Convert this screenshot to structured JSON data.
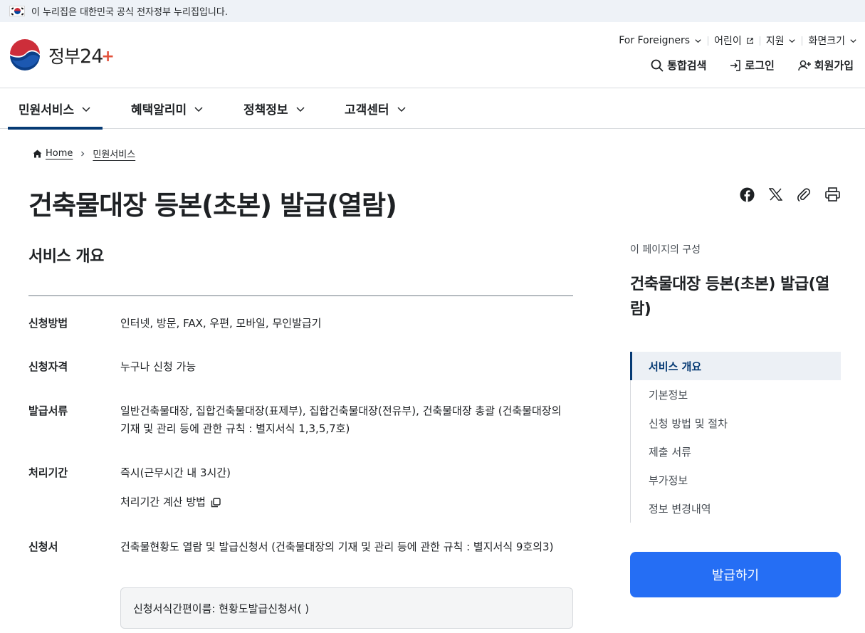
{
  "gov_banner": {
    "text": "이 누리집은 대한민국 공식 전자정부 누리집입니다."
  },
  "logo": {
    "text": "정부",
    "number": "24",
    "plus": "+"
  },
  "utility_menu": [
    {
      "label": "For Foreigners",
      "icon": "chevron-down-icon"
    },
    {
      "label": "어린이",
      "icon": "external-link-icon"
    },
    {
      "label": "지원",
      "icon": "chevron-down-icon"
    },
    {
      "label": "화면크기",
      "icon": "chevron-down-icon"
    }
  ],
  "header_actions": [
    {
      "label": "통합검색",
      "icon": "search-icon"
    },
    {
      "label": "로그인",
      "icon": "login-icon"
    },
    {
      "label": "회원가입",
      "icon": "user-plus-icon"
    }
  ],
  "nav": [
    {
      "label": "민원서비스",
      "active": true
    },
    {
      "label": "혜택알리미",
      "active": false
    },
    {
      "label": "정책정보",
      "active": false
    },
    {
      "label": "고객센터",
      "active": false
    }
  ],
  "breadcrumb": {
    "home": "Home",
    "current": "민원서비스"
  },
  "page_title": "건축물대장 등본(초본) 발급(열람)",
  "share_icons": [
    "facebook-icon",
    "x-twitter-icon",
    "link-attach-icon",
    "print-icon"
  ],
  "section_title": "서비스 개요",
  "info": {
    "method": {
      "label": "신청방법",
      "value": "인터넷, 방문, FAX, 우편, 모바일, 무인발급기"
    },
    "eligibility": {
      "label": "신청자격",
      "value": "누구나 신청 가능"
    },
    "documents": {
      "label": "발급서류",
      "value": "일반건축물대장, 집합건축물대장(표제부), 집합건축물대장(전유부), 건축물대장 총괄 (건축물대장의 기재 및 관리 등에 관한 규칙 : 별지서식 1,3,5,7호)"
    },
    "period": {
      "label": "처리기간",
      "value": "즉시(근무시간 내 3시간)",
      "link": "처리기간 계산 방법"
    },
    "form": {
      "label": "신청서",
      "value": "건축물현황도 열람 및 발급신청서 (건축물대장의 기재 및 관리 등에 관한 규칙 : 별지서식 9호의3)",
      "box": "신청서식간편이름: 현황도발급신청서( )"
    }
  },
  "toc": {
    "caption": "이 페이지의 구성",
    "title": "건축물대장 등본(초본) 발급(열람)",
    "items": [
      {
        "label": "서비스 개요",
        "active": true
      },
      {
        "label": "기본정보",
        "active": false
      },
      {
        "label": "신청 방법 및 절차",
        "active": false
      },
      {
        "label": "제출 서류",
        "active": false
      },
      {
        "label": "부가정보",
        "active": false
      },
      {
        "label": "정보 변경내역",
        "active": false
      }
    ]
  },
  "issue_button": "발급하기",
  "colors": {
    "primary": "#256ef4",
    "nav_active": "#063a74",
    "banner_bg": "#eef2f7"
  }
}
